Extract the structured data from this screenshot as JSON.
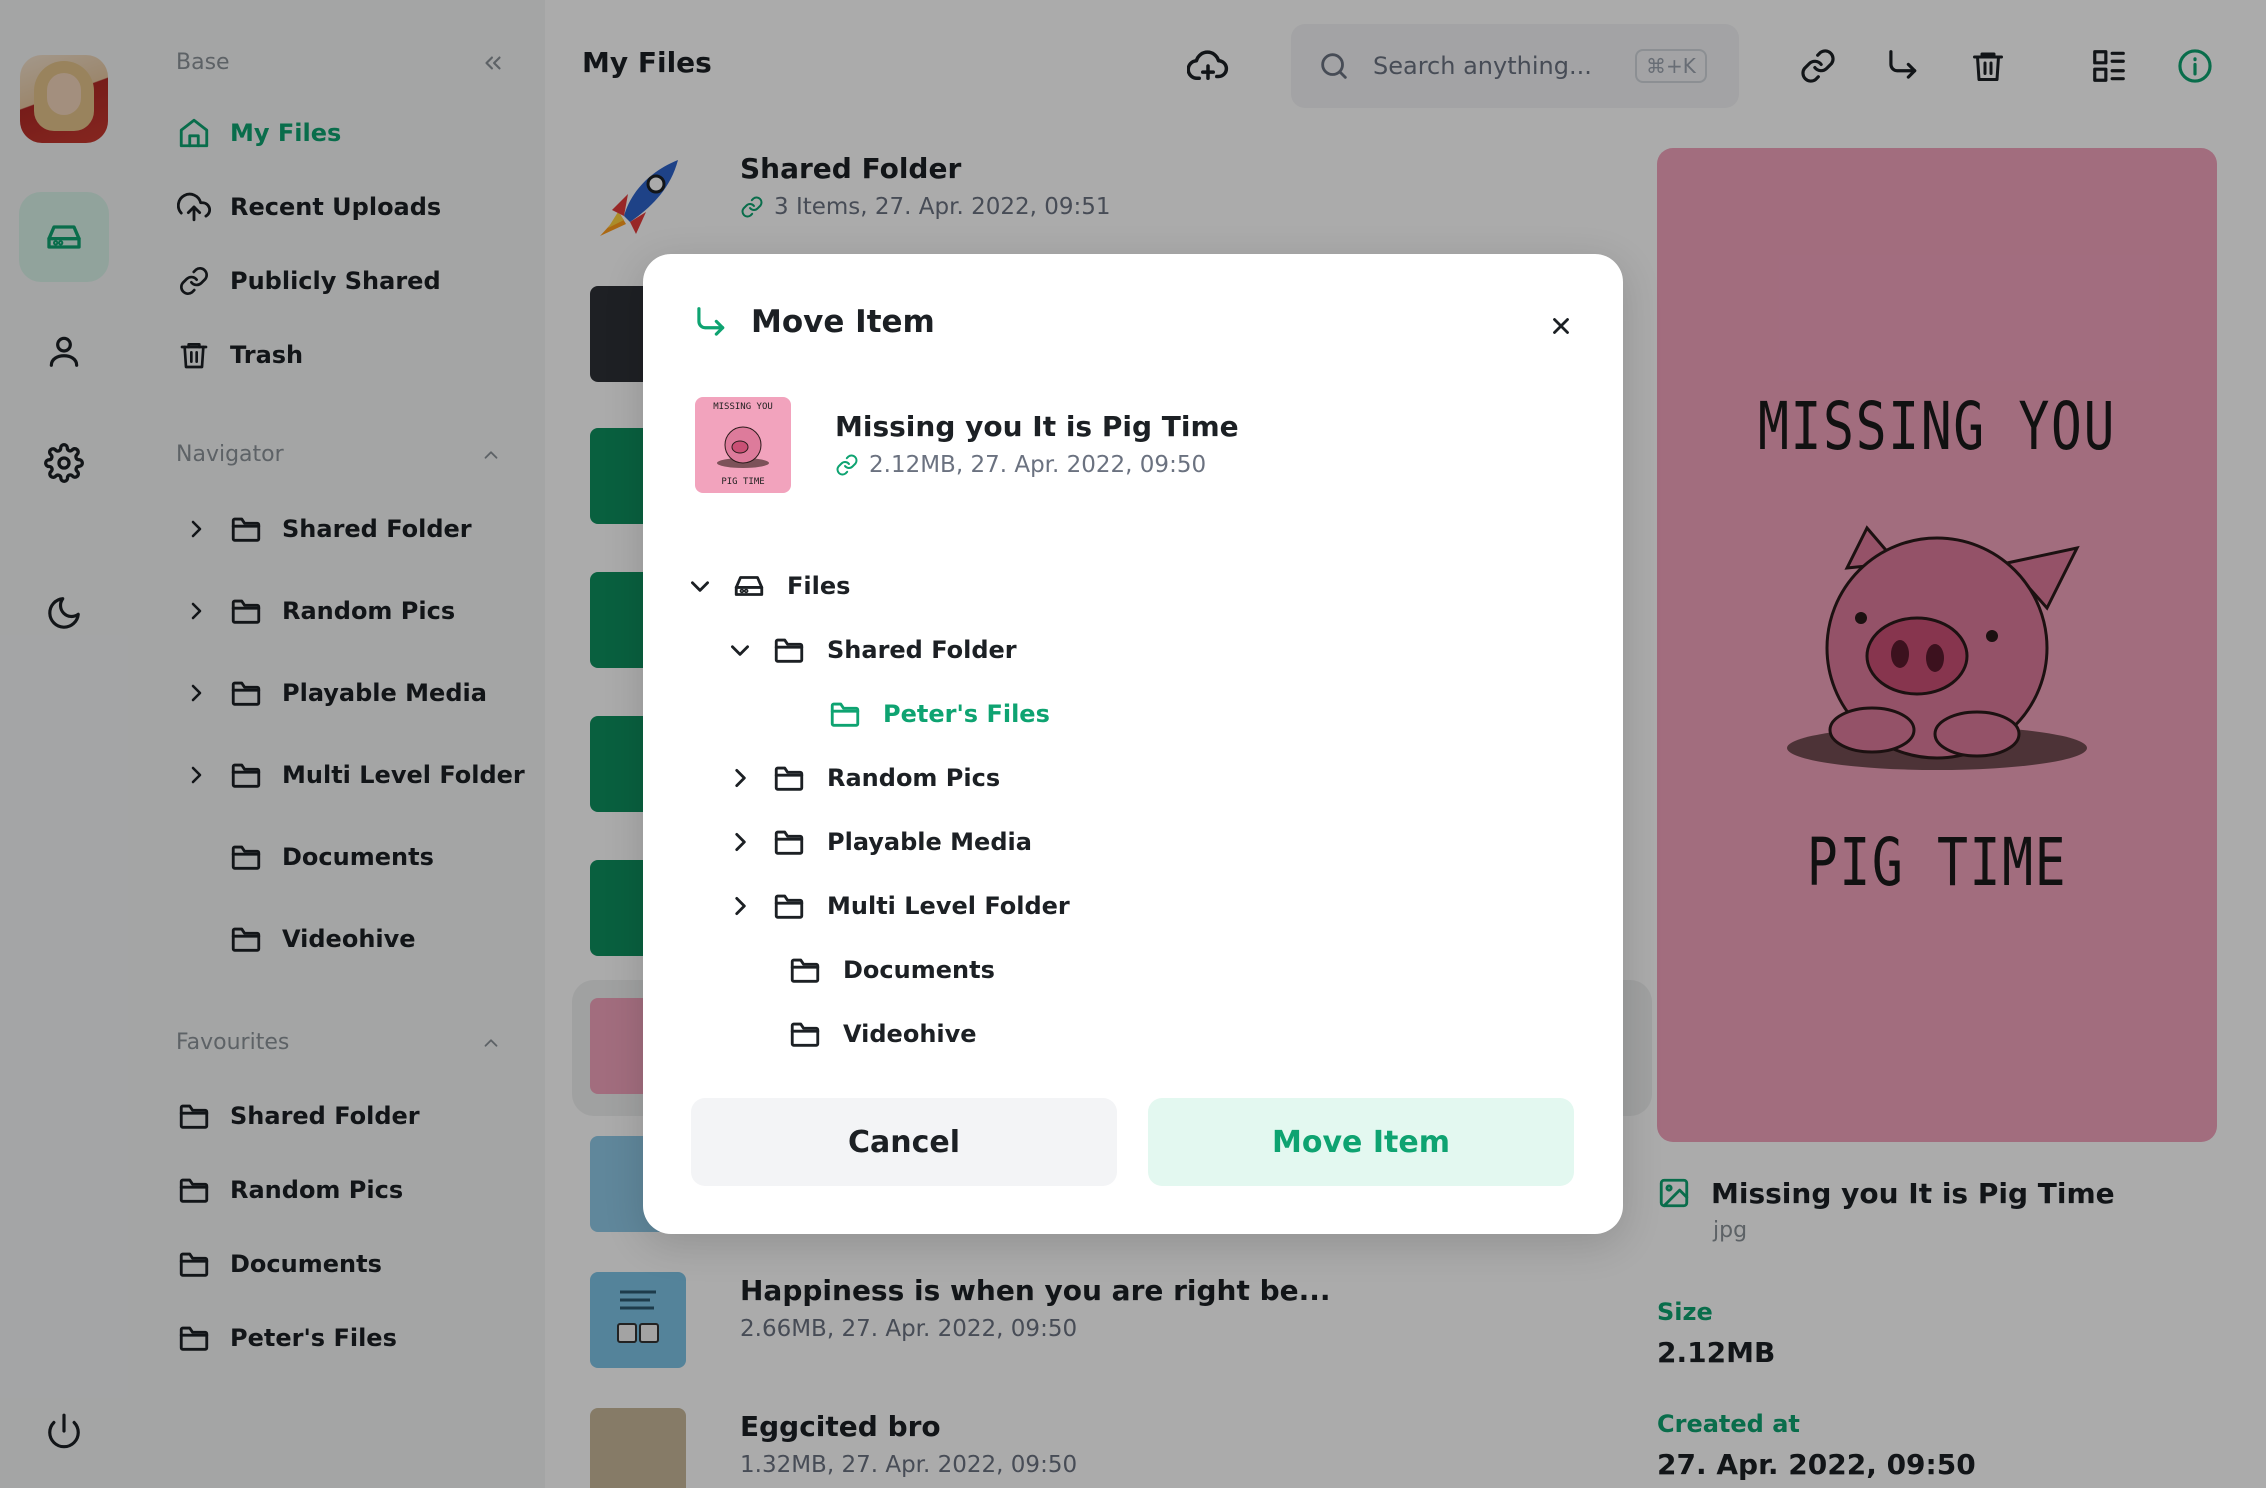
{
  "colors": {
    "accent": "#0ea371",
    "accent_bg": "#d8f3e9",
    "preview_bg": "#f2a3bd",
    "muted": "#8b9298"
  },
  "rail": {
    "avatar_alt": "user avatar",
    "icons": [
      "storage-icon",
      "user-icon",
      "settings-icon",
      "moon-icon",
      "power-icon"
    ]
  },
  "sidebar": {
    "base_title": "Base",
    "base_items": [
      {
        "label": "My Files",
        "icon": "home-icon",
        "active": true
      },
      {
        "label": "Recent Uploads",
        "icon": "cloud-upload-icon"
      },
      {
        "label": "Publicly Shared",
        "icon": "link-icon"
      },
      {
        "label": "Trash",
        "icon": "trash-icon"
      }
    ],
    "navigator_title": "Navigator",
    "navigator_items": [
      {
        "label": "Shared Folder",
        "expandable": true
      },
      {
        "label": "Random Pics",
        "expandable": true
      },
      {
        "label": "Playable Media",
        "expandable": true
      },
      {
        "label": "Multi Level Folder",
        "expandable": true
      },
      {
        "label": "Documents",
        "expandable": false
      },
      {
        "label": "Videohive",
        "expandable": false
      }
    ],
    "favourites_title": "Favourites",
    "favourites_items": [
      "Shared Folder",
      "Random Pics",
      "Documents",
      "Peter's Files"
    ]
  },
  "header": {
    "title": "My Files",
    "search_placeholder": "Search anything...",
    "search_shortcut": "⌘+K"
  },
  "files": [
    {
      "name": "Shared Folder",
      "meta": "3 Items, 27. Apr. 2022, 09:51",
      "shared": true
    },
    {
      "name": "Happiness is when you are right be...",
      "meta": "2.66MB, 27. Apr. 2022, 09:50"
    },
    {
      "name": "Eggcited bro",
      "meta": "1.32MB, 27. Apr. 2022, 09:50"
    }
  ],
  "preview": {
    "text_top": "MISSING YOU",
    "text_bottom": "PIG TIME",
    "name": "Missing you It is Pig Time",
    "type": "jpg",
    "size_label": "Size",
    "size_value": "2.12MB",
    "created_label": "Created at",
    "created_value": "27. Apr. 2022, 09:50"
  },
  "modal": {
    "title": "Move Item",
    "item_name": "Missing you It is Pig Time",
    "item_meta": "2.12MB, 27. Apr. 2022, 09:50",
    "thumb_top": "MISSING YOU",
    "thumb_bottom": "PIG TIME",
    "tree_root": "Files",
    "tree": {
      "shared_folder": "Shared Folder",
      "peters_files": "Peter's Files",
      "random_pics": "Random Pics",
      "playable_media": "Playable Media",
      "multi_level_folder": "Multi Level Folder",
      "documents": "Documents",
      "videohive": "Videohive"
    },
    "cancel_label": "Cancel",
    "move_label": "Move Item"
  }
}
